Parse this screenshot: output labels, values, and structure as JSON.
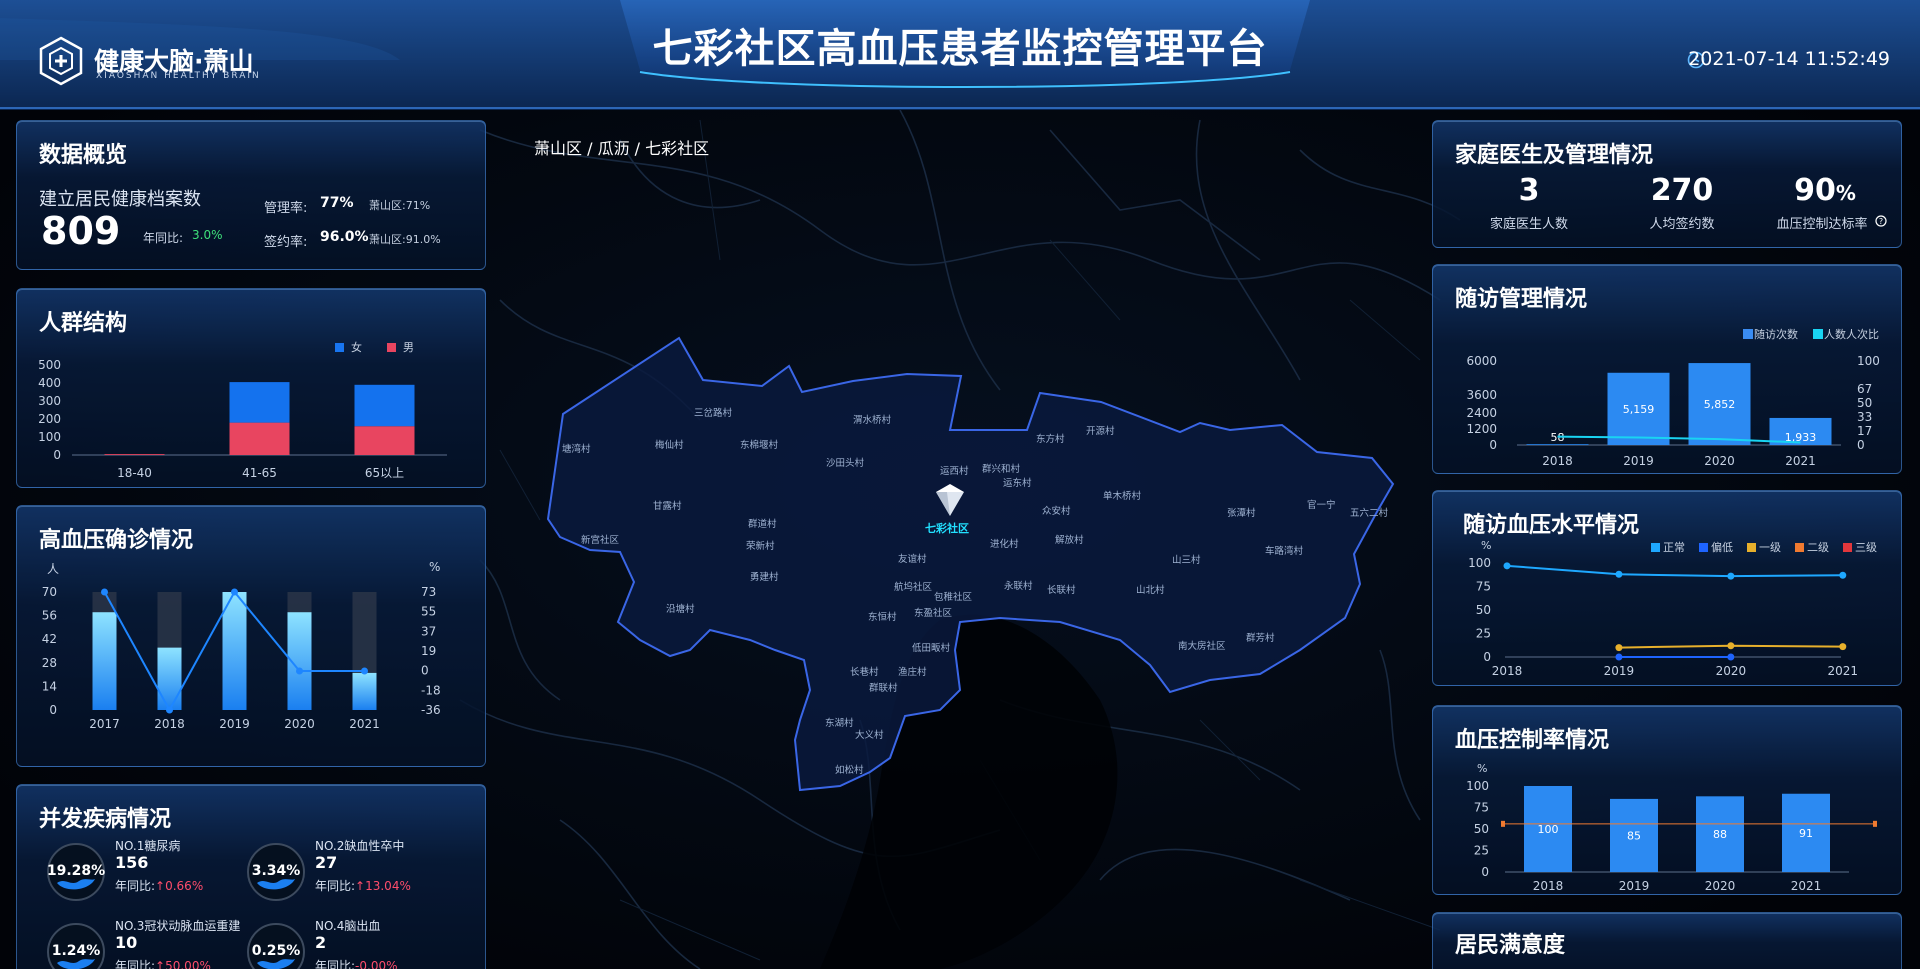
{
  "header": {
    "title": "七彩社区高血压患者监控管理平台",
    "logo_text": "健康大脑·萧山",
    "logo_sub": "XIAOSHAN HEALTHY BRAIN",
    "datetime": "2021-07-14 11:52:49"
  },
  "breadcrumb": "萧山区 / 瓜沥 / 七彩社区",
  "overview": {
    "title": "数据概览",
    "label": "建立居民健康档案数",
    "value": "809",
    "yoy_label": "年同比:",
    "yoy_value": "3.0%",
    "mgmt_label": "管理率:",
    "mgmt_value": "77%",
    "mgmt_district": "萧山区:71%",
    "sign_label": "签约率:",
    "sign_value": "96.0%",
    "sign_district": "萧山区:91.0%"
  },
  "population": {
    "title": "人群结构",
    "legend_female": "女",
    "legend_male": "男",
    "yticks": [
      "500",
      "400",
      "300",
      "200",
      "100",
      "0"
    ],
    "chart_data": {
      "type": "bar",
      "categories": [
        "18-40",
        "41-65",
        "65以上"
      ],
      "series": [
        {
          "name": "男",
          "values": [
            5,
            180,
            160
          ]
        },
        {
          "name": "女",
          "values": [
            0,
            225,
            230
          ]
        }
      ],
      "ylim": [
        0,
        500
      ]
    }
  },
  "hypertension": {
    "title": "高血压确诊情况",
    "unit_left": "人",
    "unit_right": "%",
    "left_ticks": [
      "70",
      "56",
      "42",
      "28",
      "14",
      "0"
    ],
    "right_ticks": [
      "73",
      "55",
      "37",
      "19",
      "0",
      "-18",
      "-36"
    ],
    "chart_data": {
      "type": "bar",
      "categories": [
        "2017",
        "2018",
        "2019",
        "2020",
        "2021"
      ],
      "series": [
        {
          "values": [
            58,
            37,
            70,
            58,
            22
          ]
        },
        {
          "type": "line",
          "values": [
            73,
            -36,
            73,
            0,
            0
          ]
        }
      ],
      "ylim": [
        0,
        70
      ],
      "y2lim": [
        -36,
        73
      ]
    }
  },
  "complications": {
    "title": "并发疾病情况",
    "items": [
      {
        "pct": "19.28%",
        "name": "NO.1糖尿病",
        "count": "156",
        "yoy_label": "年同比:",
        "yoy": "↑0.66%"
      },
      {
        "pct": "3.34%",
        "name": "NO.2缺血性卒中",
        "count": "27",
        "yoy_label": "年同比:",
        "yoy": "↑13.04%"
      },
      {
        "pct": "1.24%",
        "name": "NO.3冠状动脉血运重建",
        "count": "10",
        "yoy_label": "年同比:",
        "yoy": "↑50.00%"
      },
      {
        "pct": "0.25%",
        "name": "NO.4脑出血",
        "count": "2",
        "yoy_label": "年同比:",
        "yoy": "-0.00%"
      }
    ]
  },
  "family_doctor": {
    "title": "家庭医生及管理情况",
    "stats": [
      {
        "value": "3",
        "label": "家庭医生人数"
      },
      {
        "value": "270",
        "label": "人均签约数"
      },
      {
        "value": "90",
        "unit": "%",
        "label": "血压控制达标率"
      }
    ]
  },
  "followup": {
    "title": "随访管理情况",
    "legend1": "随访次数",
    "legend2": "人数人次比",
    "left_ticks": [
      "6000",
      "3600",
      "2400",
      "1200",
      "0"
    ],
    "right_ticks": [
      "100",
      "67",
      "50",
      "33",
      "17",
      "0"
    ],
    "chart_data": {
      "type": "bar",
      "categories": [
        "2018",
        "2019",
        "2020",
        "2021"
      ],
      "series": [
        {
          "name": "随访次数",
          "values": [
            58,
            5159,
            5852,
            1933
          ],
          "labels": [
            "58",
            "5,159",
            "5,852",
            "1,933"
          ]
        },
        {
          "name": "人数人次比",
          "type": "line",
          "values": [
            10,
            9,
            7,
            3
          ]
        }
      ],
      "ylim": [
        0,
        6000
      ],
      "y2lim": [
        0,
        100
      ]
    }
  },
  "bp_level": {
    "title": "随访血压水平情况",
    "unit": "%",
    "legend": [
      "正常",
      "偏低",
      "一级",
      "二级",
      "三级"
    ],
    "yticks": [
      "100",
      "75",
      "50",
      "25",
      "0"
    ],
    "chart_data": {
      "type": "line",
      "categories": [
        "2018",
        "2019",
        "2020",
        "2021"
      ],
      "series": [
        {
          "name": "正常",
          "values": [
            97,
            88,
            86,
            87
          ]
        },
        {
          "name": "偏低",
          "values": [
            null,
            0,
            0,
            null
          ]
        },
        {
          "name": "一级",
          "values": [
            null,
            10,
            12,
            11
          ]
        }
      ],
      "ylim": [
        0,
        100
      ]
    }
  },
  "bp_control": {
    "title": "血压控制率情况",
    "unit": "%",
    "yticks": [
      "100",
      "75",
      "50",
      "25",
      "0"
    ],
    "chart_data": {
      "type": "bar",
      "categories": [
        "2018",
        "2019",
        "2020",
        "2021"
      ],
      "values": [
        100,
        85,
        88,
        91
      ],
      "ylim": [
        0,
        100
      ],
      "reference_line": 56
    }
  },
  "satisfaction": {
    "title": "居民满意度"
  },
  "map": {
    "center": "七彩社区",
    "villages": [
      "三岔路村",
      "渭水桥村",
      "塘湾村",
      "梅仙村",
      "东棉堰村",
      "沙田头村",
      "东方村",
      "开源村",
      "运西村",
      "群兴和村",
      "运东村",
      "单木桥村",
      "官一宁",
      "五六二村",
      "甘露村",
      "群道村",
      "荣新村",
      "众安村",
      "解放村",
      "张潭村",
      "新宫社区",
      "勇建村",
      "友谊村",
      "进化村",
      "山三村",
      "车路湾村",
      "沿塘村",
      "航坞社区",
      "永联村",
      "长联村",
      "山北村",
      "东恒村",
      "包稚社区",
      "东盈社区",
      "低田畈村",
      "南大房社区",
      "群芳村",
      "长巷村",
      "渔庄村",
      "群联村",
      "东湖村",
      "大义村",
      "如松村"
    ]
  }
}
